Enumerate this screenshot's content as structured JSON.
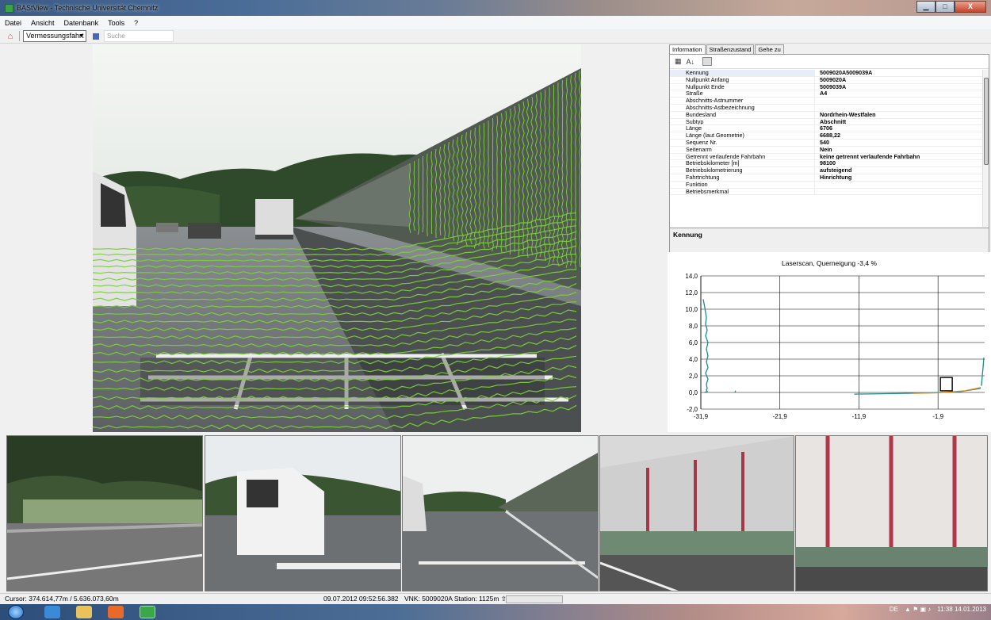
{
  "window": {
    "title": "BAStView - Technische Universität Chemnitz",
    "buttons": {
      "minimize": "▁",
      "maximize": "□",
      "close": "X"
    }
  },
  "menu": [
    "Datei",
    "Ansicht",
    "Datenbank",
    "Tools",
    "?"
  ],
  "toolbar": {
    "combo_value": "Vermessungsfahrt",
    "search_placeholder": "Suche"
  },
  "tabs": [
    "Information",
    "Straßenzustand",
    "Gehe zu"
  ],
  "properties": [
    {
      "key": "Kennung",
      "value": "5009020A5009039A"
    },
    {
      "key": "Nullpunkt Anfang",
      "value": "5009020A"
    },
    {
      "key": "Nullpunkt Ende",
      "value": "5009039A"
    },
    {
      "key": "Straße",
      "value": "A4"
    },
    {
      "key": "Abschnitts-Astnummer",
      "value": ""
    },
    {
      "key": "Abschnitts-Astbezeichnung",
      "value": ""
    },
    {
      "key": "Bundesland",
      "value": "Nordrhein-Westfalen"
    },
    {
      "key": "Subtyp",
      "value": "Abschnitt"
    },
    {
      "key": "Länge",
      "value": "6706"
    },
    {
      "key": "Länge (laut Geometrie)",
      "value": "6688,22"
    },
    {
      "key": "Sequenz Nr.",
      "value": "540"
    },
    {
      "key": "Seitenarm",
      "value": "Nein"
    },
    {
      "key": "Getrennt verlaufende Fahrbahn",
      "value": "keine getrennt verlaufende Fahrbahn"
    },
    {
      "key": "Betriebskilometer [m]",
      "value": "98100"
    },
    {
      "key": "Betriebskilometrierung",
      "value": "aufsteigend"
    },
    {
      "key": "Fahrtrichtung",
      "value": "Hinrichtung"
    },
    {
      "key": "Funktion",
      "value": ""
    },
    {
      "key": "Betriebsmerkmal",
      "value": ""
    }
  ],
  "description_title": "Kennung",
  "chart_data": {
    "type": "line",
    "title": "Laserscan, Querneigung -3,4 %",
    "xlabel": "",
    "ylabel": "",
    "ylim": [
      -2.0,
      14.0
    ],
    "xlim": [
      -31.9,
      4.0
    ],
    "y_ticks": [
      "14,0",
      "12,0",
      "10,0",
      "8,0",
      "6,0",
      "4,0",
      "2,0",
      "0,0",
      "-2,0"
    ],
    "x_ticks": [
      {
        "label": "-31,9",
        "value": -31.9
      },
      {
        "label": "-21,9",
        "value": -21.9
      },
      {
        "label": "-11,9",
        "value": -11.9
      },
      {
        "label": "-1,9",
        "value": -1.9
      }
    ],
    "grid": true,
    "series": [
      {
        "color": "#1f8a8a",
        "x": [
          -31.6,
          -31.4,
          -31.2,
          -31.3,
          -31.1,
          -31.3,
          -31.0,
          -31.2,
          -31.0,
          -31.2,
          -31.0,
          -31.3,
          -31.0,
          -31.2,
          -31.1,
          -31.2,
          -31.1,
          -31.3,
          -31.2
        ],
        "y": [
          11.2,
          10.2,
          9.0,
          8.2,
          7.5,
          6.8,
          6.0,
          5.2,
          4.4,
          3.7,
          3.0,
          2.3,
          1.6,
          1.0,
          0.5,
          0.3,
          0.1,
          0.05,
          0.0
        ]
      },
      {
        "color": "#1f8a8a",
        "x": [
          -27.6,
          -27.5
        ],
        "y": [
          0.0,
          0.2
        ]
      },
      {
        "color": "#1f8a8a",
        "x": [
          -12.5,
          -9.0,
          -6.0,
          -3.0,
          1.0,
          3.5
        ],
        "y": [
          -0.2,
          -0.15,
          -0.1,
          -0.05,
          0.1,
          0.5
        ]
      },
      {
        "color": "#e08a1a",
        "x": [
          -5.0,
          -2.0,
          1.5,
          3.5
        ],
        "y": [
          -0.1,
          -0.05,
          0.2,
          0.6
        ]
      },
      {
        "color": "#1f8a8a",
        "x": [
          3.6,
          3.7,
          3.8,
          3.9
        ],
        "y": [
          0.8,
          2.0,
          3.0,
          4.2
        ]
      }
    ],
    "marker_box": {
      "x": [
        -1.6,
        -0.1
      ],
      "y": [
        0.2,
        1.8
      ]
    }
  },
  "status": {
    "cursor": "Cursor: 374.614,77m / 5.636.073,60m",
    "datetime": "09.07.2012 09:52:56.382",
    "vnk": "VNK: 5009020A  Station: 1125m  ⇧"
  },
  "taskbar": {
    "lang": "DE",
    "time": "11:38",
    "date": "14.01.2013"
  }
}
